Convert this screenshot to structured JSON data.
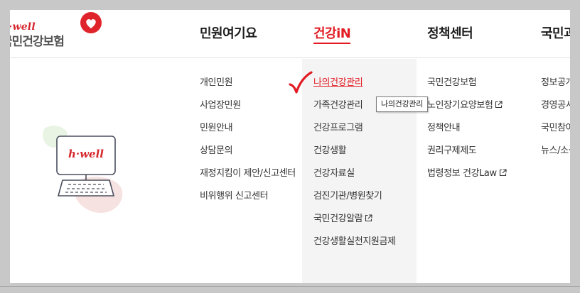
{
  "logo": {
    "hwell": "h·well",
    "name": "국민건강보험"
  },
  "nav": {
    "items": [
      {
        "label": "민원여기요"
      },
      {
        "label": "건강iN"
      },
      {
        "label": "정책센터"
      },
      {
        "label": "국민과함"
      }
    ]
  },
  "menus": {
    "civil": [
      "개인민원",
      "사업장민원",
      "민원안내",
      "상담문의",
      "재정지킴이 제안/신고센터",
      "비위행위 신고센터"
    ],
    "health": [
      "나의건강관리",
      "가족건강관리",
      "건강프로그램",
      "건강생활",
      "건강자료실",
      "검진기관/병원찾기",
      "국민건강알람",
      "건강생활실천지원금제"
    ],
    "policy": [
      "국민건강보험",
      "노인장기요양보험",
      "정책안내",
      "권리구제제도",
      "법령정보 건강Law"
    ],
    "together": [
      "정보공개",
      "경영공시",
      "국민참여",
      "뉴스/소식"
    ]
  },
  "tooltip": {
    "text": "나의건강관리"
  },
  "illustration": {
    "hwell": "h·well"
  },
  "colors": {
    "accent": "#e21b23",
    "text": "#333333",
    "active_column_bg": "#f4f4f4"
  }
}
